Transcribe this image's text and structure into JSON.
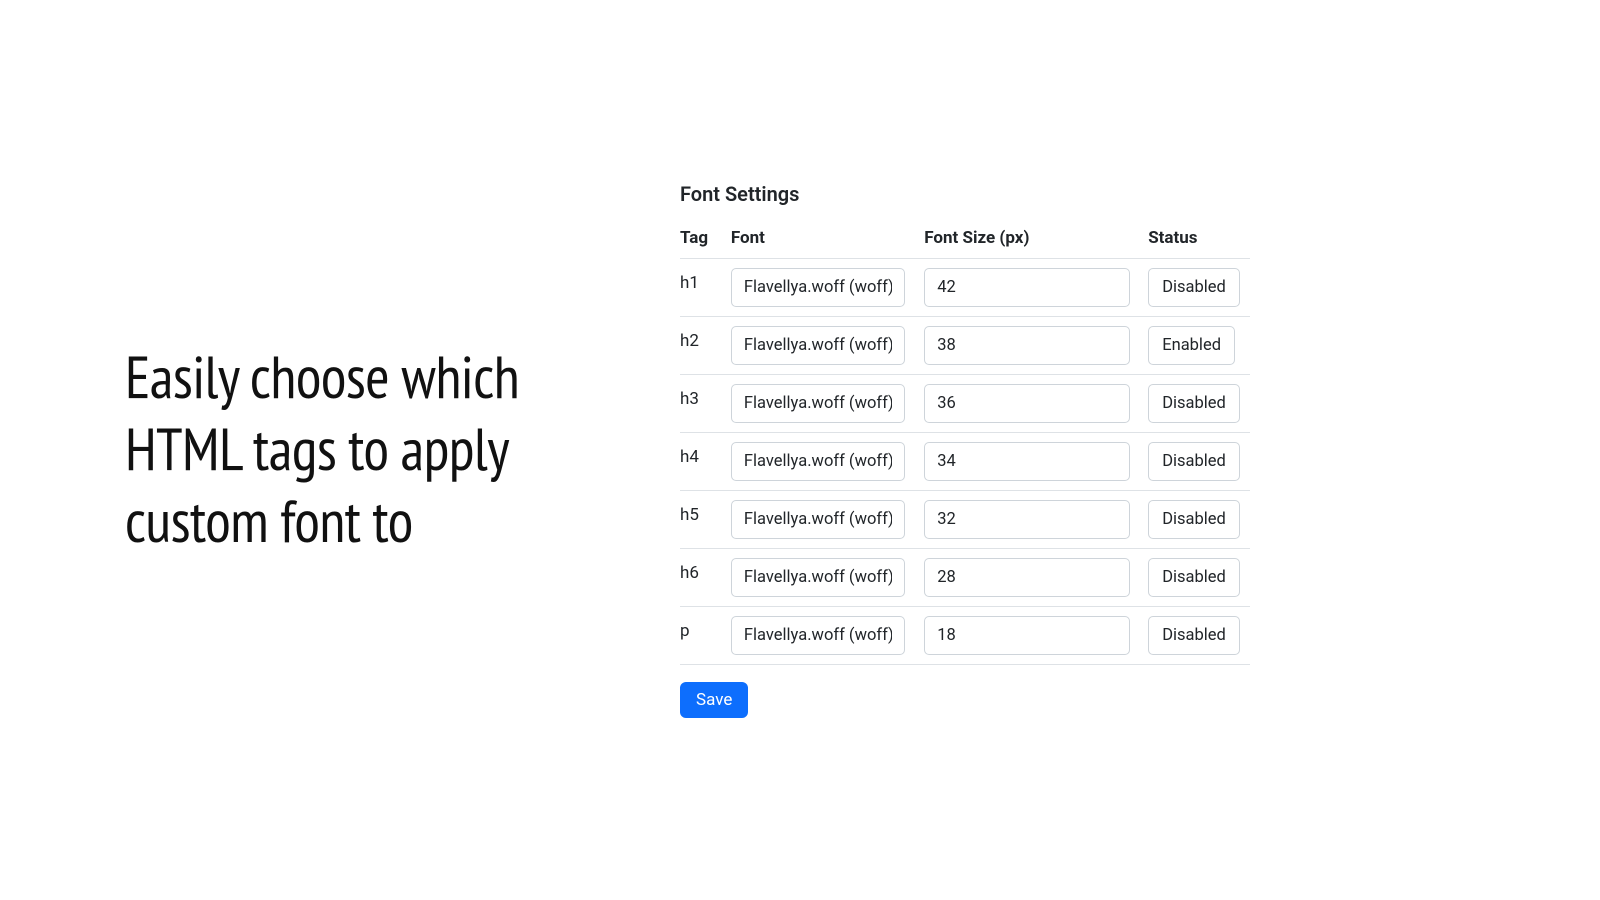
{
  "headline": "Easily choose which HTML tags to apply custom font to",
  "panel": {
    "title": "Font Settings",
    "columns": {
      "tag": "Tag",
      "font": "Font",
      "size": "Font Size (px)",
      "status": "Status"
    },
    "rows": [
      {
        "tag": "h1",
        "font": "Flavellya.woff (woff)",
        "size": "42",
        "status": "Disabled"
      },
      {
        "tag": "h2",
        "font": "Flavellya.woff (woff)",
        "size": "38",
        "status": "Enabled"
      },
      {
        "tag": "h3",
        "font": "Flavellya.woff (woff)",
        "size": "36",
        "status": "Disabled"
      },
      {
        "tag": "h4",
        "font": "Flavellya.woff (woff)",
        "size": "34",
        "status": "Disabled"
      },
      {
        "tag": "h5",
        "font": "Flavellya.woff (woff)",
        "size": "32",
        "status": "Disabled"
      },
      {
        "tag": "h6",
        "font": "Flavellya.woff (woff)",
        "size": "28",
        "status": "Disabled"
      },
      {
        "tag": "p",
        "font": "Flavellya.woff (woff)",
        "size": "18",
        "status": "Disabled"
      }
    ],
    "save_label": "Save"
  }
}
